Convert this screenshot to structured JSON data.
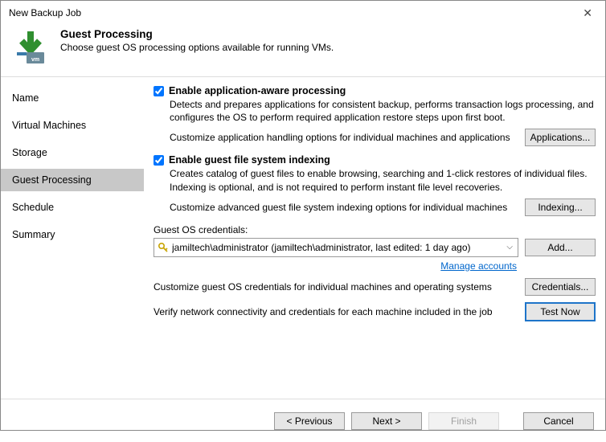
{
  "window": {
    "title": "New Backup Job"
  },
  "header": {
    "title": "Guest Processing",
    "subtitle": "Choose guest OS processing options available for running VMs."
  },
  "nav": {
    "items": [
      {
        "label": "Name"
      },
      {
        "label": "Virtual Machines"
      },
      {
        "label": "Storage"
      },
      {
        "label": "Guest Processing",
        "selected": true
      },
      {
        "label": "Schedule"
      },
      {
        "label": "Summary"
      }
    ]
  },
  "main": {
    "appAware": {
      "checked": true,
      "label": "Enable application-aware processing",
      "desc": "Detects and prepares applications for consistent backup, performs transaction logs processing, and configures the OS to perform required application restore steps upon first boot.",
      "customizeText": "Customize application handling options for individual machines and applications",
      "button": "Applications..."
    },
    "indexing": {
      "checked": true,
      "label": "Enable guest file system indexing",
      "desc": "Creates catalog of guest files to enable browsing, searching and 1-click restores of individual files. Indexing is optional, and is not required to perform instant file level recoveries.",
      "customizeText": "Customize advanced guest file system indexing options for individual machines",
      "button": "Indexing..."
    },
    "credentials": {
      "label": "Guest OS credentials:",
      "selected": "jamiltech\\administrator (jamiltech\\administrator, last edited: 1 day ago)",
      "addButton": "Add...",
      "manageLink": "Manage accounts",
      "customizeText": "Customize guest OS credentials for individual machines and operating systems",
      "credsButton": "Credentials...",
      "verifyText": "Verify network connectivity and credentials for each machine included in the job",
      "testButton": "Test Now"
    }
  },
  "footer": {
    "previous": "< Previous",
    "next": "Next >",
    "finish": "Finish",
    "cancel": "Cancel"
  }
}
